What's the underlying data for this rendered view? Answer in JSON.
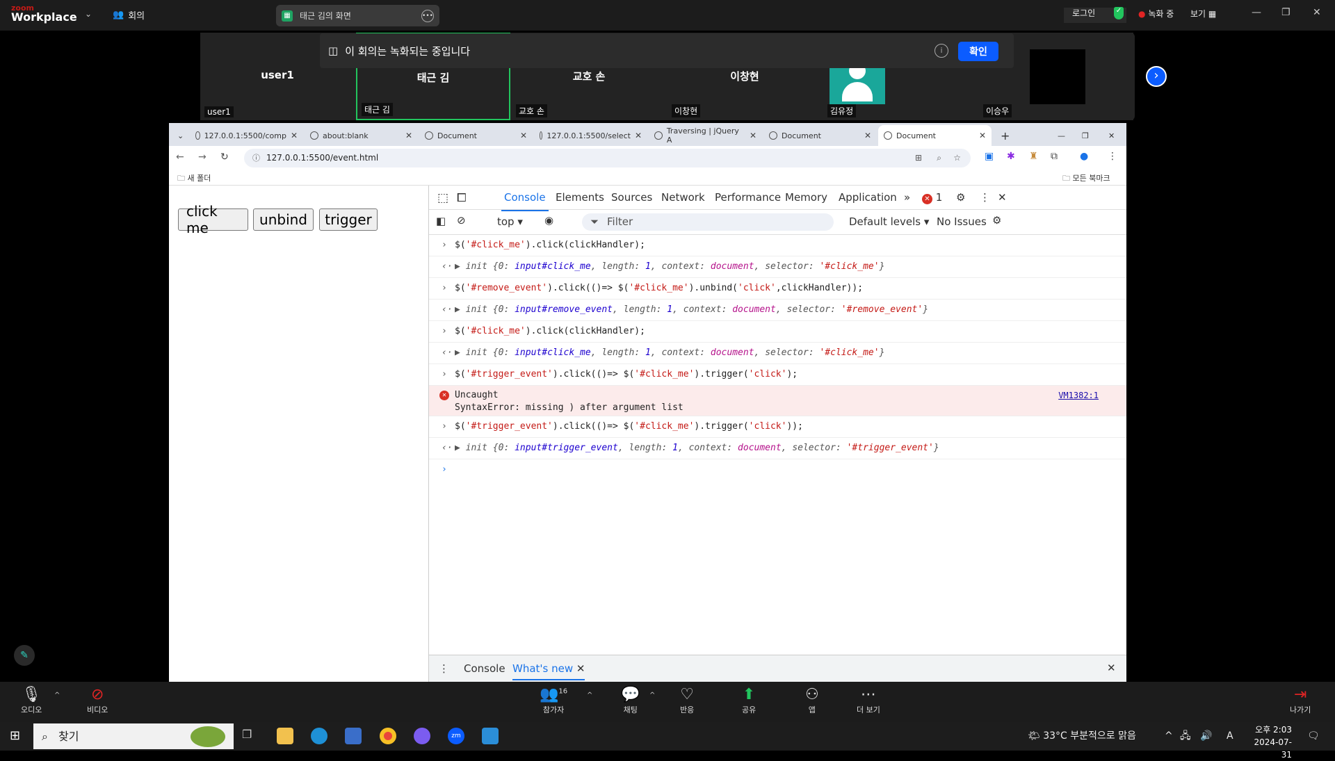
{
  "zoom": {
    "brand_small": "zoom",
    "brand": "Workplace",
    "meeting_label": "회의",
    "share_title": "태근 김의 화면",
    "login": "로그인",
    "recording": "녹화 중",
    "view": "보기",
    "participants": [
      {
        "name": "user1",
        "label": "user1"
      },
      {
        "name": "태근 김",
        "label": "태근 김"
      },
      {
        "name": "교호 손",
        "label": "교호 손"
      },
      {
        "name": "이창현",
        "label": "이창현"
      },
      {
        "name": "",
        "label": "김유정"
      },
      {
        "name": "",
        "label": "이승우"
      }
    ],
    "banner_text": "이 회의는 녹화되는 중입니다",
    "banner_ok": "확인",
    "bottom": [
      {
        "label": "오디오",
        "icon": "mic-icon"
      },
      {
        "label": "비디오",
        "icon": "video-off-icon"
      },
      {
        "label": "참가자",
        "icon": "participants-icon",
        "count": "16"
      },
      {
        "label": "채팅",
        "icon": "chat-icon"
      },
      {
        "label": "반응",
        "icon": "heart-icon"
      },
      {
        "label": "공유",
        "icon": "share-icon"
      },
      {
        "label": "앱",
        "icon": "apps-icon"
      },
      {
        "label": "더 보기",
        "icon": "more-icon"
      },
      {
        "label": "나가기",
        "icon": "leave-icon"
      }
    ]
  },
  "browser": {
    "tabs": [
      "127.0.0.1:5500/comp",
      "about:blank",
      "Document",
      "127.0.0.1:5500/select",
      "Traversing | jQuery A",
      "Document",
      "Document"
    ],
    "url": "127.0.0.1:5500/event.html",
    "bookmark_folder": "새 폴더",
    "all_bookmarks": "모든 북마크"
  },
  "page": {
    "buttons": [
      "click me",
      "unbind",
      "trigger"
    ]
  },
  "devtools": {
    "tabs": [
      "Console",
      "Elements",
      "Sources",
      "Network",
      "Performance",
      "Memory",
      "Application"
    ],
    "error_count": "1",
    "context": "top",
    "filter_placeholder": "Filter",
    "levels": "Default levels",
    "issues": "No Issues",
    "drawer_tabs": [
      "Console",
      "What's new"
    ],
    "error": {
      "title": "Uncaught",
      "message": "SyntaxError: missing ) after argument list",
      "source": "VM1382:1"
    }
  },
  "taskbar": {
    "search": "찾기",
    "weather": "33°C  부분적으로 맑음",
    "time": "오후 2:03",
    "date": "2024-07-31",
    "ime": "A"
  }
}
